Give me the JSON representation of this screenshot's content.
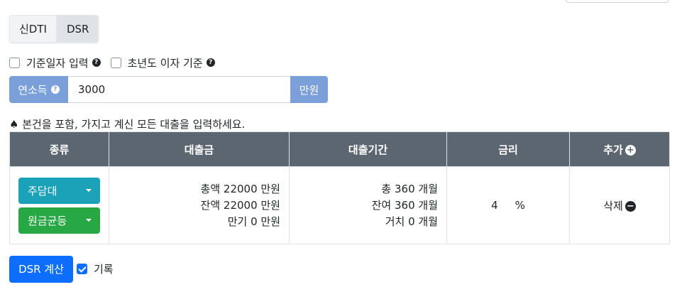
{
  "tabs": [
    "신DTI",
    "DSR"
  ],
  "options": {
    "base_date_label": "기준일자 입력",
    "first_year_label": "초년도 이자 기준"
  },
  "income": {
    "label": "연소득",
    "value": "3000",
    "unit": "만원"
  },
  "notice": "♠ 본건을 포함, 가지고 계신 모든 대출을 입력하세요.",
  "table": {
    "headers": {
      "type": "종류",
      "amount": "대출금",
      "period": "대출기간",
      "rate": "금리",
      "add": "추가"
    },
    "rows": [
      {
        "loan_type": "주담대",
        "repay_type": "원금균등",
        "amount_total": "총액 22000 만원",
        "amount_remaining": "잔액 22000 만원",
        "amount_maturity": "만기 0 만원",
        "period_total": "총 360 개월",
        "period_remaining": "잔여 360 개월",
        "period_grace": "거치 0 개월",
        "rate": "4",
        "rate_unit": "%",
        "delete_label": "삭제"
      }
    ]
  },
  "footer": {
    "calc_button": "DSR 계산",
    "record_label": "기록",
    "record_checked": true
  },
  "colors": {
    "accent": "#0d6efd",
    "input_addon": "#7b9fd8",
    "table_header": "#5c6670",
    "teal_button": "#1ba2b8",
    "green_button": "#28a745"
  }
}
